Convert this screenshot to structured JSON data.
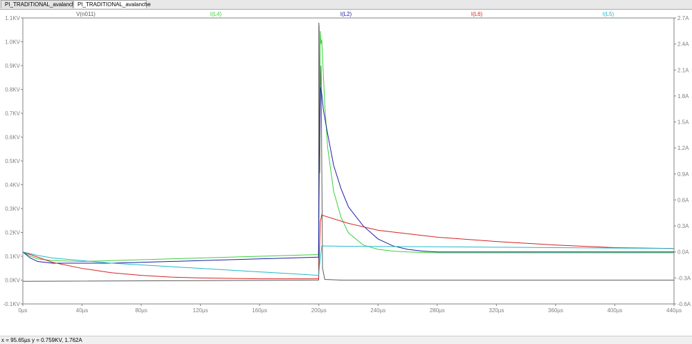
{
  "tabs": [
    {
      "label": "PI_TRADITIONAL_avalanche",
      "icon": "schematic-icon",
      "active": false
    },
    {
      "label": "PI_TRADITIONAL_avalanche",
      "icon": "waveform-icon",
      "active": true
    }
  ],
  "status": {
    "cursor_readout": "x = 95.65µs   y = 0.759KV, 1.762A"
  },
  "chart_data": {
    "type": "line",
    "xlim": [
      0,
      440
    ],
    "x_tick_values": [
      0,
      40,
      80,
      120,
      160,
      200,
      240,
      280,
      320,
      360,
      400,
      440
    ],
    "x_tick_labels": [
      "0µs",
      "40µs",
      "80µs",
      "120µs",
      "160µs",
      "200µs",
      "240µs",
      "280µs",
      "320µs",
      "360µs",
      "400µs",
      "440µs"
    ],
    "left_axis": {
      "ylim": [
        -0.1,
        1.1
      ],
      "tick_values": [
        -0.1,
        0.0,
        0.1,
        0.2,
        0.3,
        0.4,
        0.5,
        0.6,
        0.7,
        0.8,
        0.9,
        1.0,
        1.1
      ],
      "tick_labels": [
        "-0.1KV",
        "0.0KV",
        "0.1KV",
        "0.2KV",
        "0.3KV",
        "0.4KV",
        "0.5KV",
        "0.6KV",
        "0.7KV",
        "0.8KV",
        "0.9KV",
        "1.0KV",
        "1.1KV"
      ]
    },
    "right_axis": {
      "ylim": [
        -0.6,
        2.7
      ],
      "tick_values": [
        -0.6,
        -0.3,
        0.0,
        0.3,
        0.6,
        0.9,
        1.2,
        1.5,
        1.8,
        2.1,
        2.4,
        2.7
      ],
      "tick_labels": [
        "-0.6A",
        "-0.3A",
        "0.0A",
        "0.3A",
        "0.6A",
        "0.9A",
        "1.2A",
        "1.5A",
        "1.8A",
        "2.1A",
        "2.4A",
        "2.7A"
      ]
    },
    "grid": false,
    "series": [
      {
        "name": "V(n011)",
        "axis": "left",
        "color": "#5a5a5a",
        "x": [
          0,
          199.9,
          200.0,
          200.2,
          200.6,
          201.0,
          201.5,
          202.5,
          204,
          215,
          440
        ],
        "y": [
          -0.005,
          0.0,
          1.08,
          1.06,
          0.45,
          0.8,
          0.9,
          0.05,
          0.003,
          0.0,
          0.0
        ]
      },
      {
        "name": "I(L4)",
        "axis": "right",
        "color": "#3ccf3c",
        "x": [
          0,
          5,
          10,
          20,
          40,
          60,
          80,
          120,
          160,
          199.8,
          200.3,
          200.6,
          201.0,
          201.5,
          202,
          204,
          206,
          210,
          215,
          220,
          230,
          240,
          250,
          260,
          280,
          320,
          360,
          400,
          440
        ],
        "y": [
          0.0,
          -0.05,
          -0.08,
          -0.1,
          -0.11,
          -0.1,
          -0.09,
          -0.07,
          -0.05,
          -0.03,
          0.9,
          1.5,
          2.55,
          2.4,
          2.45,
          1.7,
          1.2,
          0.7,
          0.4,
          0.22,
          0.08,
          0.03,
          0.01,
          0.0,
          -0.01,
          -0.01,
          -0.01,
          -0.01,
          -0.01
        ]
      },
      {
        "name": "I(L2)",
        "axis": "right",
        "color": "#1c1ca8",
        "x": [
          0,
          5,
          10,
          20,
          40,
          60,
          80,
          120,
          160,
          199.8,
          200.3,
          200.8,
          201.2,
          202,
          203,
          205,
          210,
          215,
          220,
          230,
          240,
          250,
          260,
          270,
          280,
          320,
          360,
          400,
          440
        ],
        "y": [
          0.0,
          -0.07,
          -0.11,
          -0.13,
          -0.13,
          -0.13,
          -0.12,
          -0.1,
          -0.08,
          -0.06,
          1.1,
          1.65,
          1.9,
          1.82,
          1.65,
          1.45,
          1.0,
          0.73,
          0.52,
          0.3,
          0.15,
          0.07,
          0.03,
          0.01,
          0.0,
          0.0,
          0.0,
          0.0,
          0.0
        ]
      },
      {
        "name": "I(L6)",
        "axis": "right",
        "color": "#d42020",
        "x": [
          0,
          10,
          20,
          40,
          60,
          80,
          100,
          120,
          160,
          199.9,
          200.3,
          201,
          202,
          203,
          220,
          240,
          280,
          320,
          360,
          400,
          440
        ],
        "y": [
          0.0,
          -0.06,
          -0.12,
          -0.19,
          -0.24,
          -0.27,
          -0.29,
          -0.3,
          -0.31,
          -0.31,
          -0.05,
          0.35,
          0.43,
          0.42,
          0.33,
          0.25,
          0.17,
          0.12,
          0.08,
          0.05,
          0.04
        ]
      },
      {
        "name": "I(L5)",
        "axis": "right",
        "color": "#20b8c8",
        "x": [
          0,
          10,
          20,
          40,
          60,
          80,
          100,
          120,
          160,
          199.9,
          200.5,
          202,
          220,
          280,
          320,
          360,
          400,
          440
        ],
        "y": [
          0.0,
          -0.04,
          -0.07,
          -0.1,
          -0.13,
          -0.15,
          -0.17,
          -0.19,
          -0.23,
          -0.27,
          -0.15,
          0.07,
          0.065,
          0.06,
          0.055,
          0.05,
          0.045,
          0.04
        ]
      }
    ]
  }
}
